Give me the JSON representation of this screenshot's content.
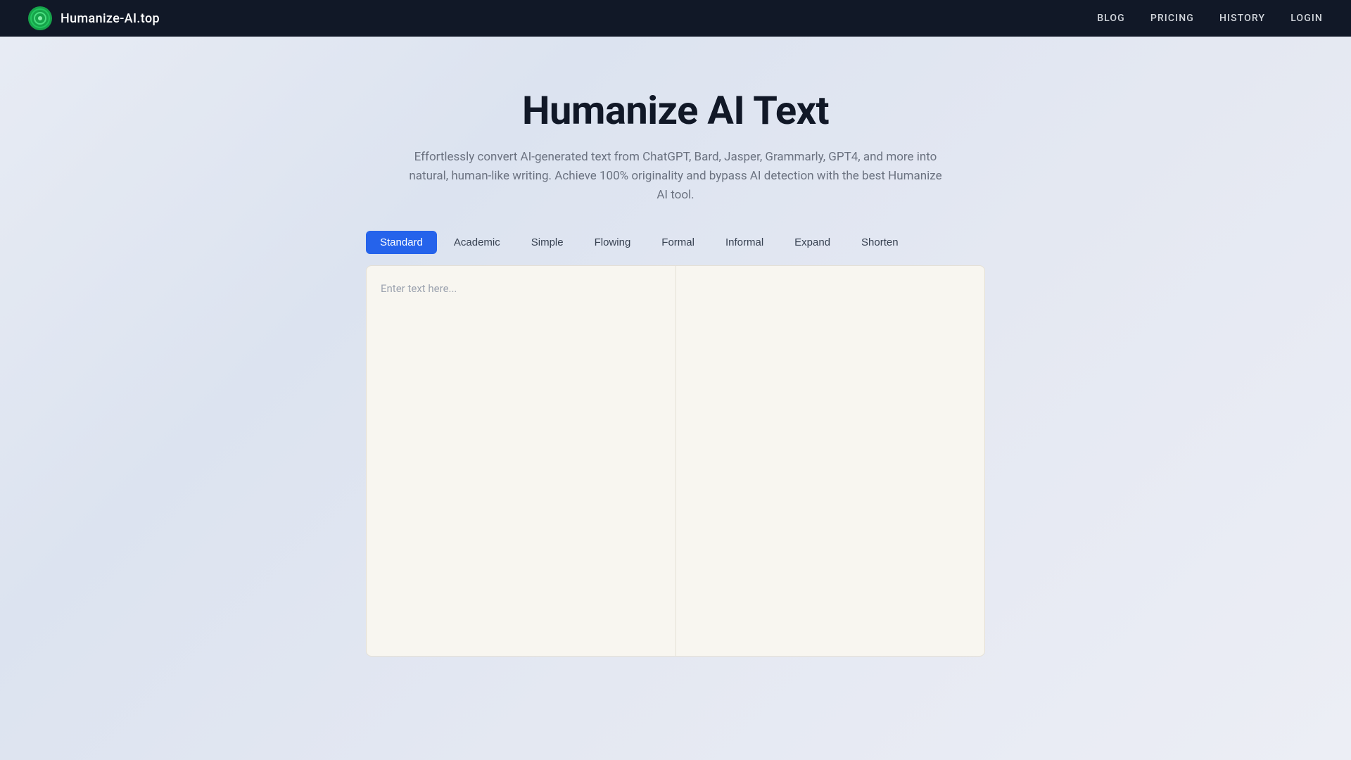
{
  "navbar": {
    "brand_name": "Humanize-AI.top",
    "nav_links": [
      {
        "label": "BLOG",
        "id": "blog"
      },
      {
        "label": "PRICING",
        "id": "pricing"
      },
      {
        "label": "HISTORY",
        "id": "history"
      },
      {
        "label": "LOGIN",
        "id": "login"
      }
    ]
  },
  "hero": {
    "title": "Humanize AI Text",
    "subtitle": "Effortlessly convert AI-generated text from ChatGPT, Bard, Jasper, Grammarly, GPT4, and more into natural, human-like writing. Achieve 100% originality and bypass AI detection with the best Humanize AI tool."
  },
  "modes": [
    {
      "label": "Standard",
      "id": "standard",
      "active": true
    },
    {
      "label": "Academic",
      "id": "academic",
      "active": false
    },
    {
      "label": "Simple",
      "id": "simple",
      "active": false
    },
    {
      "label": "Flowing",
      "id": "flowing",
      "active": false
    },
    {
      "label": "Formal",
      "id": "formal",
      "active": false
    },
    {
      "label": "Informal",
      "id": "informal",
      "active": false
    },
    {
      "label": "Expand",
      "id": "expand",
      "active": false
    },
    {
      "label": "Shorten",
      "id": "shorten",
      "active": false
    }
  ],
  "input_panel": {
    "placeholder": "Enter text here..."
  },
  "output_panel": {
    "placeholder": ""
  },
  "colors": {
    "active_tab": "#2563eb",
    "background_start": "#e8ecf4",
    "background_end": "#eceef5",
    "navbar_bg": "#111827",
    "panel_bg": "#f8f6f0"
  }
}
